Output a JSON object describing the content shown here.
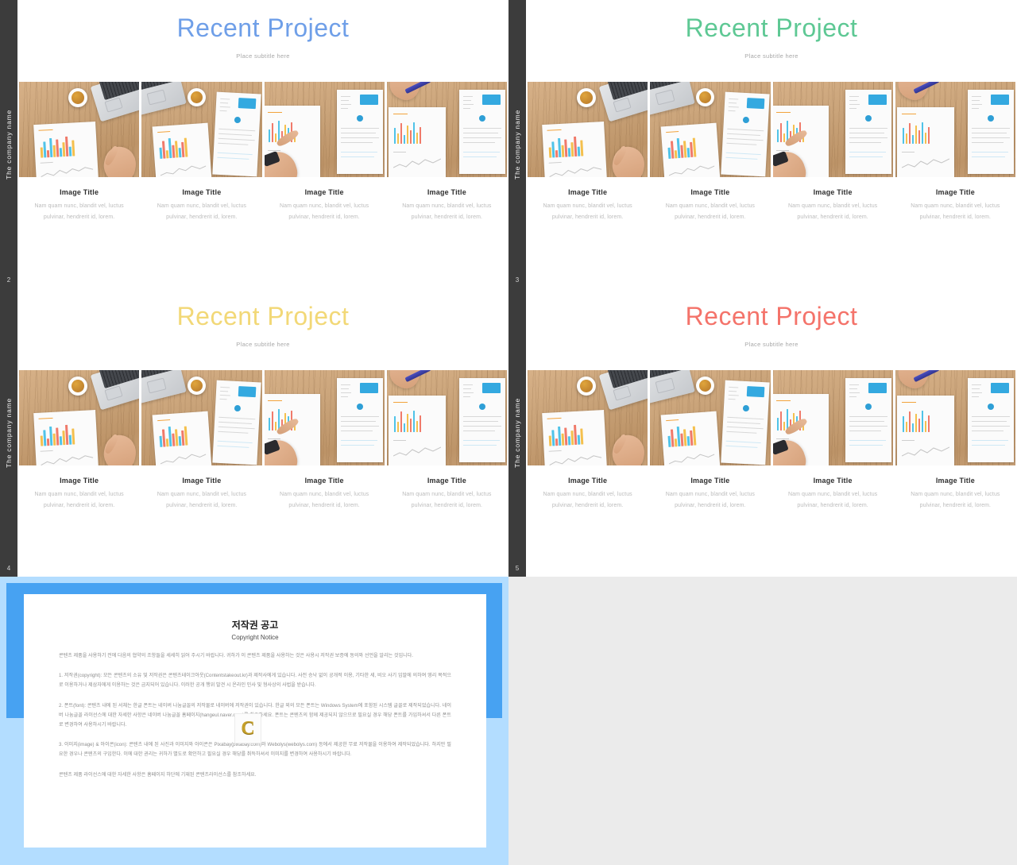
{
  "workspace": {
    "background_color": "#ebebeb"
  },
  "slides": [
    {
      "number": "2",
      "sidebar_label": "The company name",
      "title": "Recent Project",
      "title_color": "#6f9fe8",
      "subtitle": "Place subtitle here",
      "cards": [
        {
          "title": "Image Title",
          "text": "Nam quam nunc, blandit vel, luctus pulvinar, hendrerit id, lorem."
        },
        {
          "title": "Image Title",
          "text": "Nam quam nunc, blandit vel, luctus pulvinar, hendrerit id, lorem."
        },
        {
          "title": "Image Title",
          "text": "Nam quam nunc, blandit vel, luctus pulvinar, hendrerit id, lorem."
        },
        {
          "title": "Image Title",
          "text": "Nam quam nunc, blandit vel, luctus pulvinar, hendrerit id, lorem."
        }
      ]
    },
    {
      "number": "3",
      "sidebar_label": "The company name",
      "title": "Recent Project",
      "title_color": "#5ec894",
      "subtitle": "Place subtitle here",
      "cards": [
        {
          "title": "Image Title",
          "text": "Nam quam nunc, blandit vel, luctus pulvinar, hendrerit id, lorem."
        },
        {
          "title": "Image Title",
          "text": "Nam quam nunc, blandit vel, luctus pulvinar, hendrerit id, lorem."
        },
        {
          "title": "Image Title",
          "text": "Nam quam nunc, blandit vel, luctus pulvinar, hendrerit id, lorem."
        },
        {
          "title": "Image Title",
          "text": "Nam quam nunc, blandit vel, luctus pulvinar, hendrerit id, lorem."
        }
      ]
    },
    {
      "number": "4",
      "sidebar_label": "The company name",
      "title": "Recent Project",
      "title_color": "#f2d877",
      "subtitle": "Place subtitle here",
      "cards": [
        {
          "title": "Image Title",
          "text": "Nam quam nunc, blandit vel, luctus pulvinar, hendrerit id, lorem."
        },
        {
          "title": "Image Title",
          "text": "Nam quam nunc, blandit vel, luctus pulvinar, hendrerit id, lorem."
        },
        {
          "title": "Image Title",
          "text": "Nam quam nunc, blandit vel, luctus pulvinar, hendrerit id, lorem."
        },
        {
          "title": "Image Title",
          "text": "Nam quam nunc, blandit vel, luctus pulvinar, hendrerit id, lorem."
        }
      ]
    },
    {
      "number": "5",
      "sidebar_label": "The company name",
      "title": "Recent Project",
      "title_color": "#f4736a",
      "subtitle": "Place subtitle here",
      "cards": [
        {
          "title": "Image Title",
          "text": "Nam quam nunc, blandit vel, luctus pulvinar, hendrerit id, lorem."
        },
        {
          "title": "Image Title",
          "text": "Nam quam nunc, blandit vel, luctus pulvinar, hendrerit id, lorem."
        },
        {
          "title": "Image Title",
          "text": "Nam quam nunc, blandit vel, luctus pulvinar, hendrerit id, lorem."
        },
        {
          "title": "Image Title",
          "text": "Nam quam nunc, blandit vel, luctus pulvinar, hendrerit id, lorem."
        }
      ]
    }
  ],
  "copyright_slide": {
    "band_color": "#47a2f2",
    "background_color": "#b3ddff",
    "title": "저작권 공고",
    "subtitle": "Copyright Notice",
    "watermark": "C",
    "intro": "콘텐츠 제품을 사용하기 전에 다음의 협약의 조항들을 세세히 읽어 주시기 바랍니다. 귀하가 이 콘텐츠 제품을 사용하는 것은 사용시 저작권 보증에 동의와 선언을 알리는 것입니다.",
    "item1": "1. 저작권(copyright): 모든 콘텐츠의 소유 및 저작권은 콘텐츠테이크아웃(Contentstakeout.kr)과 제작사에게 있습니다. 사전 승낙 없이 공개적 이용, 기타한 세, 비오 사기 임말에 의하여 영리 목적으로 이용하거나 제삼자에게 이용하는 것은 금지되어 있습니다. 이러한 공개 행위 발견 시 온라인 민사 및 형사상의 사법을 받습니다.",
    "item2": "2. 폰트(font): 콘텐츠 내에 된 서체는 한글 폰트는 네이버 나눔글꼴의 저작물로 네이버에 저작권이 있습니다. 한글 외의 모든 폰트는 Windows System에 포함된 시스템 글꼴로 제작되었습니다. 네이버 나눔글꼴 라이선스에 대한 자세한 사항은 네이버 나눔글꼴 홈페이지(hangeul.naver.com)를 참조하세요. 폰트는 콘텐츠의 함께 제공되지 않으므로 필요실 경우 해당 폰트를 가입하셔서 다른 폰트로 변경하여 사용하시기 바랍니다.",
    "item3": "3. 이미지(image) & 아이콘(icon): 콘텐츠 내에 된 사진과 이미지와 아이콘은 Pixabay(pixabay.com)와 Webolys(webolys.com) 등에서 제공한 무료 저작물을 이용하여 제작되었습니다. 하지만 필요한 경우나 콘텐츠의 구입한다. 이에 대한 권리는 귀하가 별도로 확인하고 필요실 경우 해당를 취득하셔서 이미지를 변경하여 사용하시기 바랍니다.",
    "footer": "콘텐츠 제품 라이선스에 대한 자세한 사항은 홈페이지 하단에 기재된 콘텐츠라이선스를 참조하세요."
  }
}
